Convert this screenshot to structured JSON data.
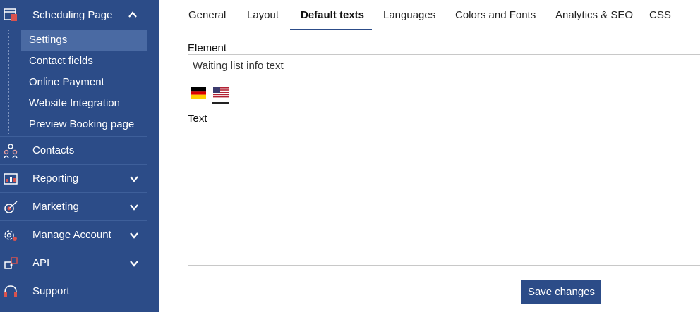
{
  "sidebar": {
    "header": {
      "label": "Scheduling Page",
      "icon": "scheduling-page-icon"
    },
    "submenu": [
      "Settings",
      "Contact fields",
      "Online Payment",
      "Website Integration",
      "Preview Booking page"
    ],
    "items": [
      {
        "label": "Contacts",
        "icon": "contacts-icon",
        "expandable": false
      },
      {
        "label": "Reporting",
        "icon": "reporting-icon",
        "expandable": true
      },
      {
        "label": "Marketing",
        "icon": "marketing-icon",
        "expandable": true
      },
      {
        "label": "Manage Account",
        "icon": "manage-account-icon",
        "expandable": true
      },
      {
        "label": "API",
        "icon": "api-icon",
        "expandable": true
      },
      {
        "label": "Support",
        "icon": "support-icon",
        "expandable": false
      }
    ]
  },
  "tabs": [
    "General",
    "Layout",
    "Default texts",
    "Languages",
    "Colors and Fonts",
    "Analytics & SEO",
    "CSS"
  ],
  "active_tab": "Default texts",
  "form": {
    "element_label": "Element",
    "element_value": "Waiting list info text",
    "flags": [
      "german-flag-icon",
      "us-flag-icon"
    ],
    "text_label": "Text",
    "text_value": ""
  },
  "save_button": "Save changes",
  "colors": {
    "sidebar": "#2c4c88",
    "sidebar_active": "#4a6aa3",
    "accent": "#2c4c88"
  }
}
